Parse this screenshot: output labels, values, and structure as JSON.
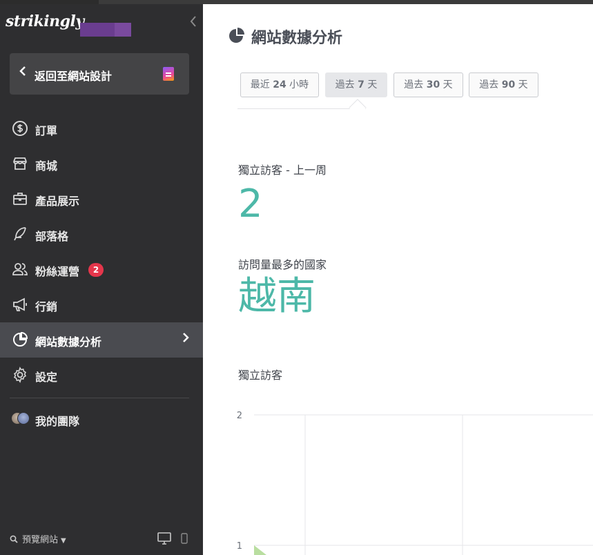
{
  "sidebar": {
    "logo": "strikingly",
    "back_label": "返回至網站設計",
    "nav": [
      {
        "label": "訂單",
        "icon": "dollar-circle-icon"
      },
      {
        "label": "商城",
        "icon": "store-icon"
      },
      {
        "label": "產品展示",
        "icon": "briefcase-icon"
      },
      {
        "label": "部落格",
        "icon": "feather-pen-icon"
      },
      {
        "label": "粉絲運營",
        "icon": "users-icon",
        "badge": "2"
      },
      {
        "label": "行銷",
        "icon": "megaphone-icon"
      },
      {
        "label": "網站數據分析",
        "icon": "pie-chart-icon",
        "active": true
      },
      {
        "label": "設定",
        "icon": "gear-icon"
      }
    ],
    "team_label": "我的團隊",
    "preview_label": "預覽網站"
  },
  "main": {
    "title": "網站數據分析",
    "range_tabs": [
      {
        "prefix": "最近 ",
        "num": "24",
        "suffix": " 小時"
      },
      {
        "prefix": "過去 ",
        "num": "7",
        "suffix": " 天",
        "active": true
      },
      {
        "prefix": "過去 ",
        "num": "30",
        "suffix": " 天"
      },
      {
        "prefix": "過去 ",
        "num": "90",
        "suffix": " 天"
      }
    ],
    "unique_visitors_label": "獨立訪客 - 上一周",
    "unique_visitors_value": "2",
    "top_country_label": "訪問量最多的國家",
    "top_country_value": "越南",
    "chart_title": "獨立訪客"
  },
  "colors": {
    "accent": "#4db8a8",
    "sidebar_bg": "#2e2e30",
    "sidebar_active": "#4a4b50",
    "badge": "#e5364b"
  },
  "chart_data": {
    "type": "area",
    "title": "獨立訪客",
    "y_ticks": [
      "2",
      "1"
    ],
    "ylim": [
      1,
      2
    ],
    "grid": true,
    "series": [
      {
        "values": [
          1
        ]
      }
    ]
  }
}
